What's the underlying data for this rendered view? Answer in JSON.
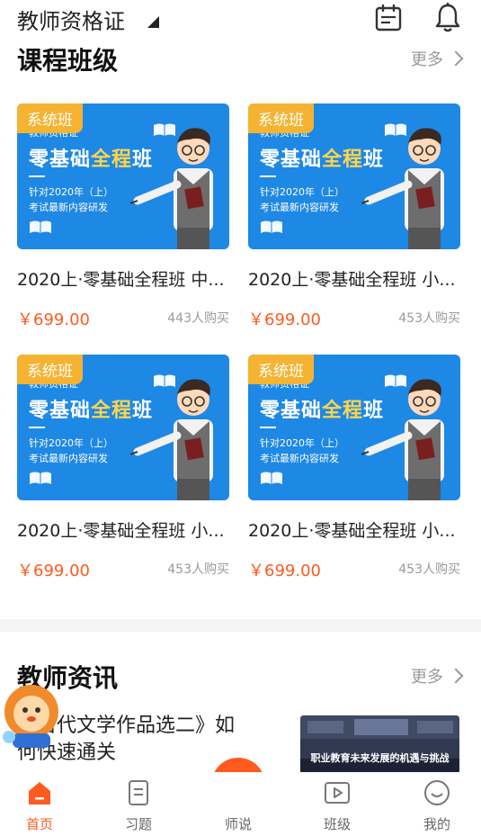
{
  "header": {
    "exam_selector": "教师资格证",
    "icons": [
      "calendar-icon",
      "bell-icon"
    ]
  },
  "courses_section": {
    "title": "课程班级",
    "more_label": "更多",
    "cards": [
      {
        "tag": "系统班",
        "banner_sub": "教师资格证",
        "banner_main_a": "零基础",
        "banner_main_hl": "全程",
        "banner_main_b": "班",
        "banner_line1": "针对2020年（上）",
        "banner_line2": "考试最新内容研发",
        "title": "2020上·零基础全程班 中...",
        "price": "￥699.00",
        "buyers": "443人购买"
      },
      {
        "tag": "系统班",
        "banner_sub": "教师资格证",
        "banner_main_a": "零基础",
        "banner_main_hl": "全程",
        "banner_main_b": "班",
        "banner_line1": "针对2020年（上）",
        "banner_line2": "考试最新内容研发",
        "title": "2020上·零基础全程班 小...",
        "price": "￥699.00",
        "buyers": "453人购买"
      },
      {
        "tag": "系统班",
        "banner_sub": "教师资格证",
        "banner_main_a": "零基础",
        "banner_main_hl": "全程",
        "banner_main_b": "班",
        "banner_line1": "针对2020年（上）",
        "banner_line2": "考试最新内容研发",
        "title": "2020上·零基础全程班 小...",
        "price": "￥699.00",
        "buyers": "453人购买"
      },
      {
        "tag": "系统班",
        "banner_sub": "教师资格证",
        "banner_main_a": "零基础",
        "banner_main_hl": "全程",
        "banner_main_b": "班",
        "banner_line1": "针对2020年（上）",
        "banner_line2": "考试最新内容研发",
        "title": "2020上·零基础全程班 小...",
        "price": "￥699.00",
        "buyers": "453人购买"
      }
    ]
  },
  "news_section": {
    "title": "教师资讯",
    "more_label": "更多",
    "item": {
      "title": "国古代文学作品选二》如何快速通关",
      "thumb_caption": "职业教育未来发展的机遇与挑战"
    }
  },
  "tabbar": {
    "tabs": [
      {
        "label": "首页",
        "icon": "home-icon",
        "active": true
      },
      {
        "label": "习题",
        "icon": "exercise-icon",
        "active": false
      },
      {
        "label": "师说",
        "icon": "paper-plane-icon",
        "active": false
      },
      {
        "label": "班级",
        "icon": "class-play-icon",
        "active": false
      },
      {
        "label": "我的",
        "icon": "profile-icon",
        "active": false
      }
    ]
  },
  "colors": {
    "accent": "#ff5a1f",
    "banner_blue": "#1e88e5",
    "tag_yellow": "#f6b332",
    "muted_text": "#9a9a9a"
  }
}
